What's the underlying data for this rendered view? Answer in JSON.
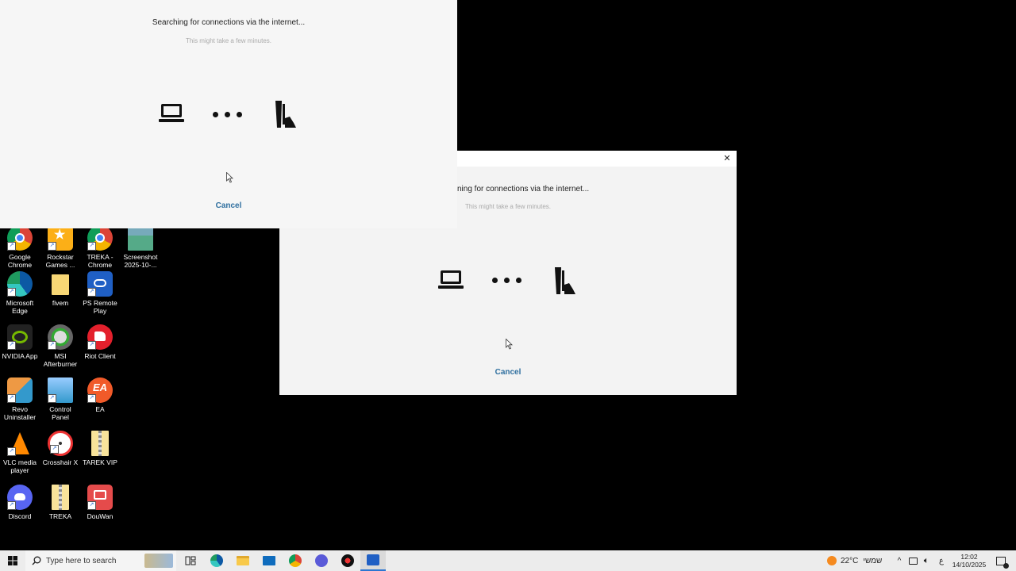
{
  "dialog_back": {
    "status": "Searching for connections via the internet...",
    "subtitle": "This might take a few minutes.",
    "cancel": "Cancel"
  },
  "dialog_front": {
    "status": "ning for connections via the internet...",
    "subtitle": "This might take a few minutes.",
    "cancel": "Cancel",
    "close_glyph": "✕"
  },
  "desktop_icons": [
    {
      "label": "Google Chrome",
      "icon": "chrome-icon"
    },
    {
      "label": "Rockstar Games ...",
      "icon": "rockstar-icon"
    },
    {
      "label": "TREKA - Chrome",
      "icon": "chrome-icon"
    },
    {
      "label": "Screenshot 2025-10-...",
      "icon": "image-file-icon"
    },
    {
      "label": "Microsoft Edge",
      "icon": "edge-icon"
    },
    {
      "label": "fivem",
      "icon": "folder-icon"
    },
    {
      "label": "PS Remote Play",
      "icon": "ps-remote-play-icon"
    },
    {
      "label": "NVIDIA App",
      "icon": "nvidia-icon"
    },
    {
      "label": "MSI Afterburner",
      "icon": "msi-afterburner-icon"
    },
    {
      "label": "Riot Client",
      "icon": "riot-client-icon"
    },
    {
      "label": "Revo Uninstaller",
      "icon": "revo-uninstaller-icon"
    },
    {
      "label": "Control Panel",
      "icon": "control-panel-icon"
    },
    {
      "label": "EA",
      "icon": "ea-icon"
    },
    {
      "label": "VLC media player",
      "icon": "vlc-icon"
    },
    {
      "label": "Crosshair X",
      "icon": "crosshair-x-icon"
    },
    {
      "label": "TAREK VIP",
      "icon": "zip-folder-icon"
    },
    {
      "label": "Discord",
      "icon": "discord-icon"
    },
    {
      "label": "TREKA",
      "icon": "zip-folder-icon"
    },
    {
      "label": "DouWan",
      "icon": "douwan-icon"
    }
  ],
  "taskbar": {
    "search_placeholder": "Type here to search",
    "weather_temp": "22°C",
    "weather_text": "שמשי",
    "lang": "ع",
    "time": "12:02",
    "date": "14/10/2025",
    "apps": [
      "task-view-icon",
      "edge-icon",
      "file-explorer-icon",
      "mail-icon",
      "chrome-icon",
      "ps-remote-play-icon",
      "steam-icon",
      "remote-play-icon"
    ]
  },
  "colors": {
    "dialog_bg": "#f6f6f6",
    "cancel": "#2f6f9f",
    "taskbar_bg": "#ececec",
    "desktop_bg": "#000000"
  }
}
